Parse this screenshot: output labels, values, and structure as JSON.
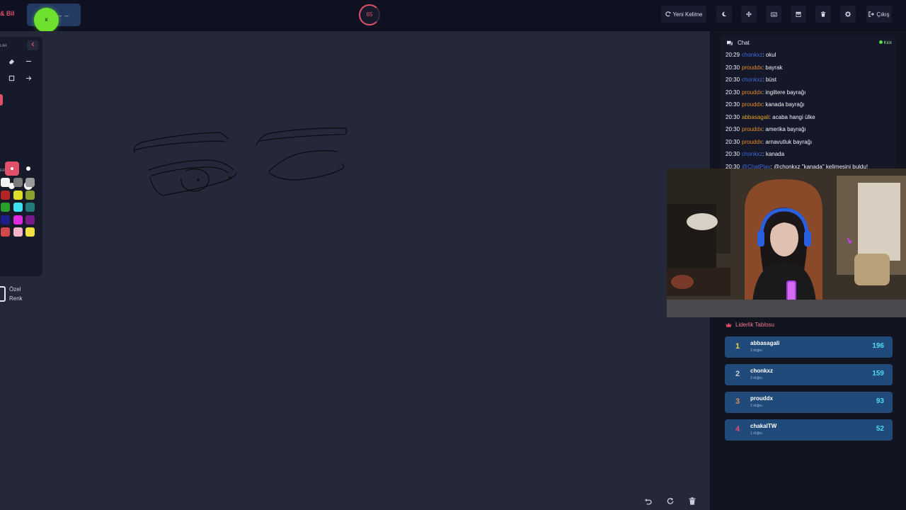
{
  "header": {
    "brand": "& Bil",
    "word_mask": "_ _",
    "avatar_mark": "x",
    "timer": "65",
    "buttons": [
      {
        "label": "Yeni Kelime",
        "icon": "refresh-icon"
      },
      {
        "label": "",
        "icon": "moon-icon"
      },
      {
        "label": "",
        "icon": "move-icon"
      },
      {
        "label": "",
        "icon": "keyboard-icon"
      },
      {
        "label": "",
        "icon": "archive-icon"
      },
      {
        "label": "",
        "icon": "trash-icon"
      },
      {
        "label": "",
        "icon": "gear-icon"
      },
      {
        "label": "Çıkış",
        "icon": "logout-icon"
      }
    ]
  },
  "tools": {
    "label_top": "LAR",
    "label_mid": "ER",
    "custom_label_1": "Özel",
    "custom_label_2": "Renk",
    "palette": [
      "#f2f2f2",
      "#7a7a7a",
      "#9b9b9b",
      "#b32424",
      "#e0e02a",
      "#8da12e",
      "#2a9e2a",
      "#3fe0ef",
      "#227a7a",
      "#1a1f8a",
      "#e02ae0",
      "#7a1a8a",
      "#d04a4a",
      "#f3b6c6",
      "#f0e040"
    ]
  },
  "chat": {
    "title": "Chat",
    "platform": "Kick",
    "messages": [
      {
        "time": "20:29",
        "user": "chonkxz",
        "color": "#3f68d8",
        "text": ": okul"
      },
      {
        "time": "20:30",
        "user": "prouddx",
        "color": "#e88b2a",
        "text": ": bayrak"
      },
      {
        "time": "20:30",
        "user": "chonkxz",
        "color": "#3f68d8",
        "text": ": büst"
      },
      {
        "time": "20:30",
        "user": "prouddx",
        "color": "#e88b2a",
        "text": ": ingiltere bayrağı"
      },
      {
        "time": "20:30",
        "user": "prouddx",
        "color": "#e88b2a",
        "text": ": kanada bayrağı"
      },
      {
        "time": "20:30",
        "user": "abbasagali",
        "color": "#e0a02a",
        "text": ": acaba hangi ülke"
      },
      {
        "time": "20:30",
        "user": "prouddx",
        "color": "#e88b2a",
        "text": ": amerika bayrağı"
      },
      {
        "time": "20:30",
        "user": "prouddx",
        "color": "#e88b2a",
        "text": ": arnavutluk bayrağı"
      },
      {
        "time": "20:30",
        "user": "chonkxz",
        "color": "#3f68d8",
        "text": ": kanada"
      },
      {
        "time": "20:30",
        "user": "@ChatPlay",
        "color": "#3f68d8",
        "text": ": @chonkxz \"kanada\" kelimesini buldu!"
      }
    ]
  },
  "leaderboard": {
    "title": "Liderlik Tablosu",
    "rows": [
      {
        "rank": "1",
        "name": "abbasagali",
        "sub": "3 doğru",
        "score": "196",
        "rank_color": "#f0d040"
      },
      {
        "rank": "2",
        "name": "chonkxz",
        "sub": "3 doğru",
        "score": "159",
        "rank_color": "#c8ccd8"
      },
      {
        "rank": "3",
        "name": "prouddx",
        "sub": "2 doğru",
        "score": "93",
        "rank_color": "#e0904a"
      },
      {
        "rank": "4",
        "name": "chakalTW",
        "sub": "1 doğru",
        "score": "52",
        "rank_color": "#e0506a"
      }
    ]
  }
}
